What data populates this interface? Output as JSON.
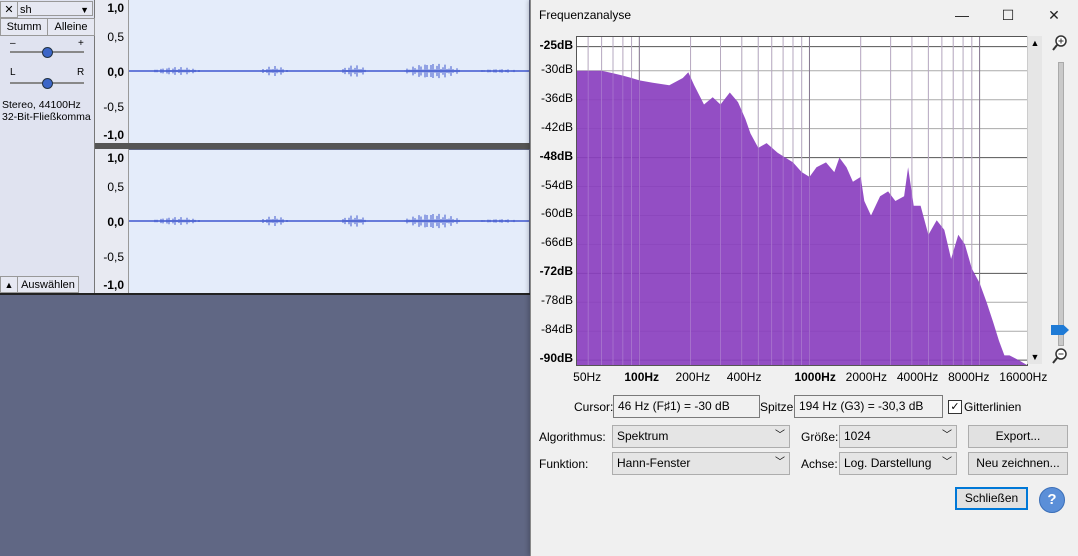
{
  "track": {
    "name": "sh",
    "mute_label": "Stumm",
    "solo_label": "Alleine",
    "gain_minus": "–",
    "gain_plus": "+",
    "pan_left": "L",
    "pan_right": "R",
    "info_line1": "Stereo, 44100Hz",
    "info_line2": "32-Bit-Fließkomma",
    "select_label": "Auswählen",
    "close_glyph": "✕",
    "collapse_glyph": "▲",
    "menu_glyph": "▼"
  },
  "ruler": {
    "upper": [
      "1,0",
      "0,5",
      "0,0",
      "-0,5",
      "-1,0"
    ],
    "lower": [
      "1,0",
      "0,5",
      "0,0",
      "-0,5",
      "-1,0"
    ]
  },
  "dialog": {
    "title": "Frequenzanalyse",
    "minimize_glyph": "—",
    "maximize_glyph": "☐",
    "close_glyph": "✕",
    "cursor_label": "Cursor:",
    "cursor_value": "46 Hz (F♯1) = -30 dB",
    "peak_label": "Spitze:",
    "peak_value": "194 Hz (G3) = -30,3 dB",
    "grid_label": "Gitterlinien",
    "grid_checked": true,
    "algorithm_label": "Algorithmus:",
    "algorithm_value": "Spektrum",
    "size_label": "Größe:",
    "size_value": "1024",
    "export_label": "Export...",
    "function_label": "Funktion:",
    "function_value": "Hann-Fenster",
    "axis_label": "Achse:",
    "axis_value": "Log. Darstellung",
    "redraw_label": "Neu zeichnen...",
    "close_label": "Schließen",
    "help_glyph": "?",
    "zoom_in_icon": "magnifier-plus-icon",
    "zoom_out_icon": "magnifier-minus-icon"
  },
  "colors": {
    "spectrum_fill": "#8a3fbf",
    "waveform": "#3f57cf",
    "track_bg": "#e4ecfa",
    "workspace": "#606784",
    "slider_thumb": "#1f7bd6"
  },
  "chart_data": {
    "type": "area",
    "yticks": [
      "-25dB",
      "-30dB",
      "-36dB",
      "-42dB",
      "-48dB",
      "-54dB",
      "-60dB",
      "-66dB",
      "-72dB",
      "-78dB",
      "-84dB",
      "-90dB"
    ],
    "xticks": [
      "50Hz",
      "100Hz",
      "200Hz",
      "400Hz",
      "1000Hz",
      "2000Hz",
      "4000Hz",
      "8000Hz",
      "16000Hz"
    ],
    "bold_yticks": [
      "-25dB",
      "-48dB",
      "-72dB",
      "-90dB"
    ],
    "bold_xticks": [
      "100Hz",
      "1000Hz"
    ],
    "xscale": "log",
    "xlim": [
      43,
      19000
    ],
    "ylim": [
      -91,
      -23
    ],
    "grid": true,
    "series": [
      {
        "x": [
          43,
          50,
          60,
          70,
          80,
          90,
          100,
          120,
          150,
          180,
          194,
          210,
          240,
          270,
          300,
          340,
          380,
          420,
          450,
          500,
          560,
          650,
          800,
          900,
          1000,
          1100,
          1250,
          1400,
          1500,
          1650,
          1800,
          2000,
          2100,
          2300,
          2600,
          2900,
          3200,
          3600,
          3800,
          4100,
          4500,
          5000,
          5600,
          6200,
          6800,
          7500,
          8200,
          9000,
          10000,
          11000,
          12000,
          13000,
          14000,
          15000,
          17000,
          19000
        ],
        "y": [
          -30,
          -30,
          -30,
          -30.5,
          -31,
          -31.5,
          -32,
          -32.5,
          -33,
          -31.5,
          -30.3,
          -33,
          -37,
          -35.5,
          -37,
          -34.5,
          -36.5,
          -40,
          -43,
          -46,
          -45,
          -47,
          -49,
          -51,
          -52,
          -50,
          -49,
          -51,
          -48,
          -50,
          -53,
          -52,
          -57,
          -60,
          -56,
          -55,
          -57,
          -56,
          -50,
          -58,
          -58,
          -64,
          -61,
          -63,
          -69,
          -64,
          -66,
          -71,
          -74,
          -78,
          -82,
          -86,
          -89,
          -89,
          -90,
          -91
        ]
      }
    ]
  }
}
